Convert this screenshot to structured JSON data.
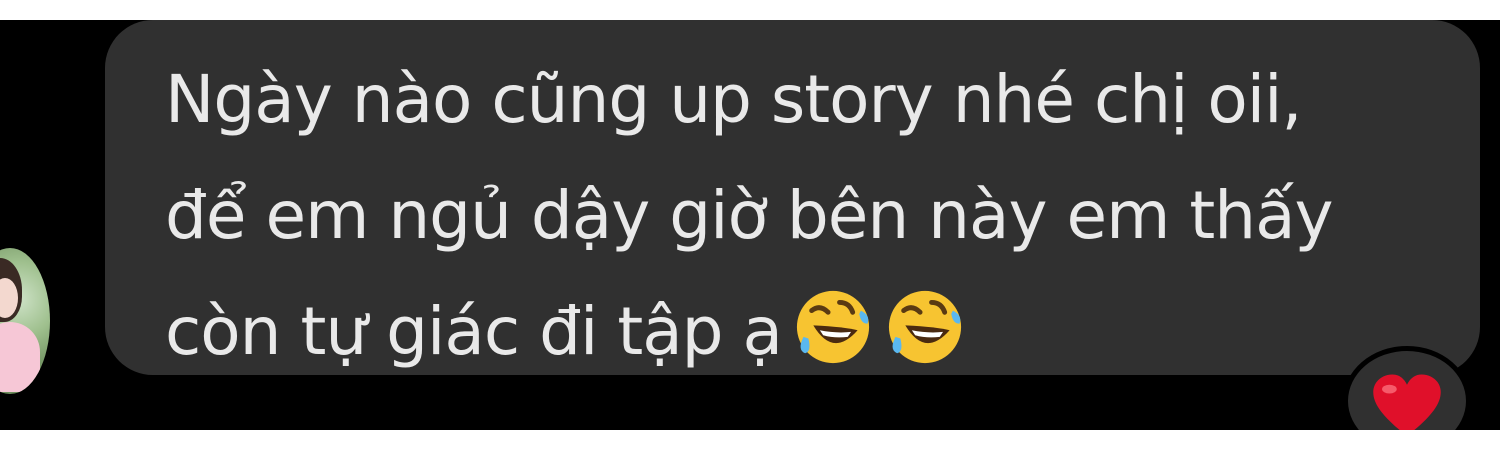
{
  "chat": {
    "message": {
      "lines": [
        "Ngày nào cũng up story nhé chị oii,",
        "để em ngủ dậy giờ bên này em thấy",
        "còn tự giác đi tập ạ"
      ],
      "emojis": [
        "rolling-on-the-floor-laughing",
        "rolling-on-the-floor-laughing"
      ]
    },
    "reaction": {
      "icon": "red-heart",
      "color": "#e0102a"
    },
    "colors": {
      "background": "#000000",
      "bubble": "#303030",
      "text": "#e9e9e9"
    }
  }
}
